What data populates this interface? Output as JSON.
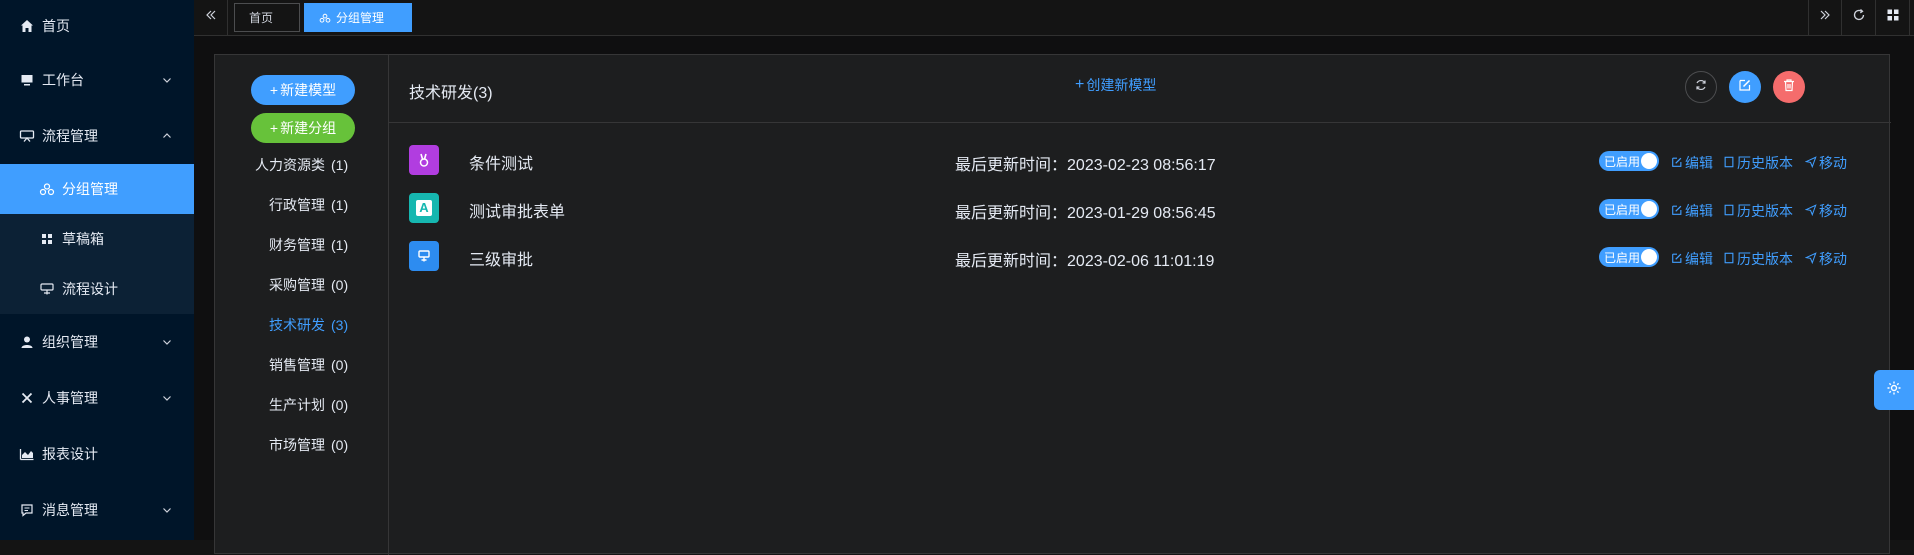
{
  "sidebar": {
    "items": [
      {
        "label": "首页",
        "icon": "home-icon"
      },
      {
        "label": "工作台",
        "icon": "monitor-icon"
      },
      {
        "label": "流程管理",
        "icon": "flow-icon"
      },
      {
        "label": "分组管理",
        "icon": "group-icon"
      },
      {
        "label": "草稿箱",
        "icon": "grid-icon"
      },
      {
        "label": "流程设计",
        "icon": "design-icon"
      },
      {
        "label": "组织管理",
        "icon": "user-icon"
      },
      {
        "label": "人事管理",
        "icon": "close-icon"
      },
      {
        "label": "报表设计",
        "icon": "chart-icon"
      },
      {
        "label": "消息管理",
        "icon": "message-icon"
      }
    ]
  },
  "tabs": [
    {
      "label": "首页"
    },
    {
      "label": "分组管理"
    }
  ],
  "groups": {
    "new_model_label": "新建模型",
    "new_group_label": "新建分组",
    "items": [
      {
        "label": "人力资源类",
        "count": "(1)"
      },
      {
        "label": "行政管理",
        "count": "(1)"
      },
      {
        "label": "财务管理",
        "count": "(1)"
      },
      {
        "label": "采购管理",
        "count": "(0)"
      },
      {
        "label": "技术研发",
        "count": "(3)"
      },
      {
        "label": "销售管理",
        "count": "(0)"
      },
      {
        "label": "生产计划",
        "count": "(0)"
      },
      {
        "label": "市场管理",
        "count": "(0)"
      }
    ]
  },
  "main": {
    "title": "技术研发(3)",
    "create_label": "创建新模型",
    "time_prefix": "最后更新时间：",
    "rows": [
      {
        "name": "条件测试",
        "time": "2023-02-23 08:56:17",
        "icon_color": "#b13de0",
        "icon": "rabbit-icon",
        "status": "已启用"
      },
      {
        "name": "测试审批表单",
        "time": "2023-01-29 08:56:45",
        "icon_color": "#16b7b0",
        "icon": "letter-a-icon",
        "glyph": "A",
        "status": "已启用"
      },
      {
        "name": "三级审批",
        "time": "2023-02-06 11:01:19",
        "icon_color": "#2d8cf0",
        "icon": "stamp-icon",
        "status": "已启用"
      }
    ],
    "actions": {
      "edit": "编辑",
      "history": "历史版本",
      "move": "移动"
    }
  },
  "colors": {
    "accent": "#409eff",
    "green": "#67c23a",
    "danger": "#f56c6c",
    "sidebar_bg": "#001529"
  }
}
